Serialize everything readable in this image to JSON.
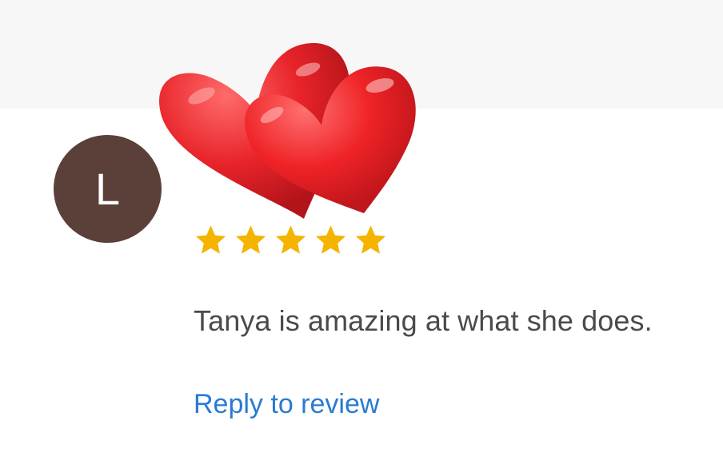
{
  "review": {
    "avatar_initial": "L",
    "avatar_color": "#5a4038",
    "sticker_icon": "two-hearts-icon",
    "rating": 5,
    "rating_max": 5,
    "star_color": "#f5b400",
    "text": "Tanya is amazing at what she does.",
    "reply_label": "Reply to review",
    "link_color": "#2a7ad2"
  }
}
